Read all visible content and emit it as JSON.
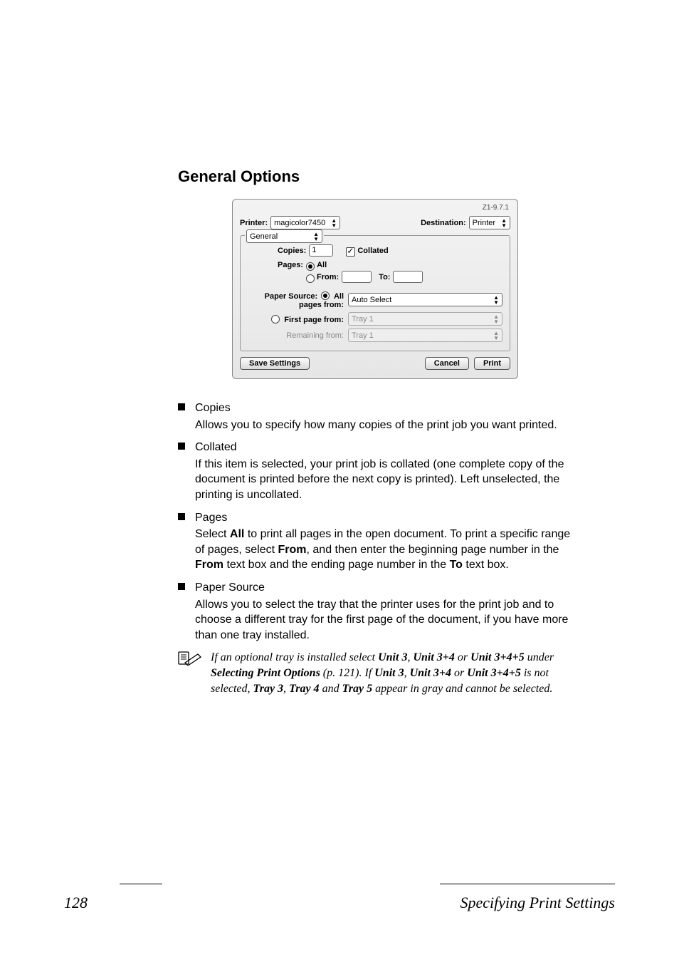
{
  "heading": "General Options",
  "dialog": {
    "version": "Z1-9.7.1",
    "printer_label": "Printer:",
    "printer_value": "magicolor7450",
    "destination_label": "Destination:",
    "destination_value": "Printer",
    "tab_value": "General",
    "copies_label": "Copies:",
    "copies_value": "1",
    "collated_label": "Collated",
    "collated_checked": true,
    "pages_label": "Pages:",
    "pages_all_label": "All",
    "pages_from_label": "From:",
    "pages_to_label": "To:",
    "source_label": "Paper Source:",
    "all_pages_label": "All pages from:",
    "all_pages_value": "Auto Select",
    "first_page_label": "First page from:",
    "first_page_value": "Tray 1",
    "remaining_label": "Remaining from:",
    "remaining_value": "Tray 1",
    "save_btn": "Save Settings",
    "cancel_btn": "Cancel",
    "print_btn": "Print"
  },
  "bullets": [
    {
      "title": "Copies",
      "body": "Allows you to specify how many copies of the print job you want printed."
    },
    {
      "title": "Collated",
      "body": "If this item is selected, your print job is collated (one complete copy of the document is printed before the next copy is printed). Left unselected, the printing is uncollated."
    },
    {
      "title": "Pages",
      "body_parts": [
        "Select ",
        "All",
        " to print all pages in the open document. To print a specific range of pages, select ",
        "From",
        ", and then enter the beginning page number in the ",
        "From",
        " text box and the ending page number in the ",
        "To",
        " text box."
      ]
    },
    {
      "title": "Paper Source",
      "body": "Allows you to select the tray that the printer uses for the print job and to choose a different tray for the first page of the document, if you have more than one tray installed."
    }
  ],
  "note_parts": [
    "If an optional tray is installed select ",
    "Unit 3",
    ", ",
    "Unit 3+4",
    " or ",
    "Unit 3+4+5",
    " under ",
    "Selecting Print Options",
    " (p. 121). If ",
    "Unit 3",
    ", ",
    "Unit 3+4",
    " or ",
    "Unit 3+4+5",
    " is not selected, ",
    "Tray 3",
    ", ",
    "Tray 4",
    " and ",
    "Tray 5",
    " appear in gray and cannot be selected."
  ],
  "footer": {
    "page": "128",
    "section": "Specifying Print Settings"
  }
}
